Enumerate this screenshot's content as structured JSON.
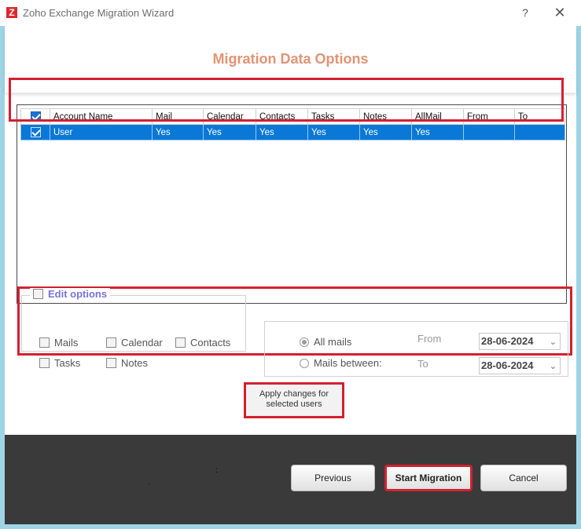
{
  "window": {
    "logo_letter": "Z",
    "title": "Zoho Exchange Migration Wizard",
    "help": "?",
    "close": "✕"
  },
  "page": {
    "title": "Migration Data Options"
  },
  "grid": {
    "columns": [
      "Account Name",
      "Mail",
      "Calendar",
      "Contacts",
      "Tasks",
      "Notes",
      "AllMail",
      "From",
      "To"
    ],
    "rows": [
      {
        "selected": true,
        "cells": [
          "User",
          "Yes",
          "Yes",
          "Yes",
          "Yes",
          "Yes",
          "Yes",
          "",
          ""
        ]
      }
    ]
  },
  "edit_options": {
    "label": "Edit options",
    "items": {
      "mails": "Mails",
      "calendar": "Calendar",
      "contacts": "Contacts",
      "tasks": "Tasks",
      "notes": "Notes"
    }
  },
  "date_filter": {
    "all_mails": "All mails",
    "mails_between": "Mails between:",
    "from_label": "From",
    "to_label": "To",
    "from_value": "28-06-2024",
    "to_value": "28-06-2024"
  },
  "apply": {
    "line1": "Apply changes for",
    "line2": "selected users"
  },
  "footer": {
    "previous": "Previous",
    "start": "Start Migration",
    "cancel": "Cancel"
  },
  "colors": {
    "accent": "#0a78d7",
    "highlight_border": "#d3202f",
    "title_color": "#e39373"
  }
}
